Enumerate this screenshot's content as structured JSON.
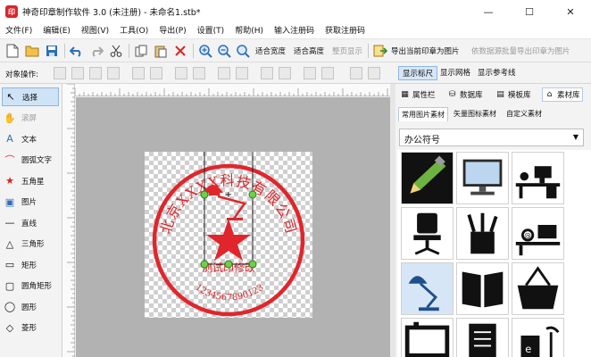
{
  "window": {
    "title": "神奇印章制作软件 3.0 (未注册) - 未命名1.stb*",
    "app_icon_glyph": "印",
    "controls": {
      "minimize": "—",
      "maximize": "☐",
      "close": "✕"
    }
  },
  "menu": [
    "文件(F)",
    "编辑(E)",
    "视图(V)",
    "工具(O)",
    "导出(P)",
    "设置(T)",
    "帮助(H)",
    "输入注册码",
    "获取注册码"
  ],
  "toolbar": {
    "fit_width": "适合宽度",
    "fit_height": "适合高度",
    "full_display": "整页显示",
    "export_image": "导出当前印章为图片",
    "export_bg": "依数据源批量导出印章为图片"
  },
  "object_bar": {
    "label": "对象操作:",
    "tabs": [
      "显示标尺",
      "显示网格",
      "显示参考线"
    ]
  },
  "tools": [
    {
      "name": "select",
      "icon": "pointer-icon",
      "glyph": "↖",
      "label": "选择",
      "active": true,
      "disabled": false
    },
    {
      "name": "pan",
      "icon": "hand-icon",
      "glyph": "✋",
      "label": "滚屏",
      "active": false,
      "disabled": true
    },
    {
      "name": "text",
      "icon": "text-icon",
      "glyph": "A",
      "label": "文本",
      "active": false,
      "disabled": false
    },
    {
      "name": "arc-text",
      "icon": "arc-text-icon",
      "glyph": "⌒",
      "label": "圆弧文字",
      "active": false,
      "disabled": false
    },
    {
      "name": "star",
      "icon": "star-icon",
      "glyph": "★",
      "label": "五角星",
      "active": false,
      "disabled": false
    },
    {
      "name": "image",
      "icon": "image-icon",
      "glyph": "▣",
      "label": "图片",
      "active": false,
      "disabled": false
    },
    {
      "name": "line",
      "icon": "line-icon",
      "glyph": "—",
      "label": "直线",
      "active": false,
      "disabled": false
    },
    {
      "name": "triangle",
      "icon": "triangle-icon",
      "glyph": "△",
      "label": "三角形",
      "active": false,
      "disabled": false
    },
    {
      "name": "rectangle",
      "icon": "rectangle-icon",
      "glyph": "▭",
      "label": "矩形",
      "active": false,
      "disabled": false
    },
    {
      "name": "rounded-rect",
      "icon": "rounded-rect-icon",
      "glyph": "▢",
      "label": "圆角矩形",
      "active": false,
      "disabled": false
    },
    {
      "name": "ellipse",
      "icon": "ellipse-icon",
      "glyph": "◯",
      "label": "圆形",
      "active": false,
      "disabled": false
    },
    {
      "name": "diamond",
      "icon": "diamond-icon",
      "glyph": "◇",
      "label": "菱形",
      "active": false,
      "disabled": false
    }
  ],
  "stamp": {
    "arc_text": "北京XXXX科技有限公司",
    "subtitle": "测试印修改",
    "number": "1234567890123",
    "color": "#e0262c"
  },
  "panel": {
    "tabs": [
      {
        "icon": "properties-icon",
        "label": "属性栏"
      },
      {
        "icon": "database-icon",
        "label": "数据库"
      },
      {
        "icon": "template-icon",
        "label": "模板库"
      },
      {
        "icon": "library-icon",
        "label": "素材库"
      }
    ],
    "sub_tabs": [
      "常用图片素材",
      "矢量图标素材",
      "自定义素材"
    ],
    "category": "办公符号",
    "cells": [
      {
        "name": "pencil-symbol"
      },
      {
        "name": "monitor-symbol"
      },
      {
        "name": "desk-computer-symbol"
      },
      {
        "name": "office-chair-symbol"
      },
      {
        "name": "pen-holder-symbol"
      },
      {
        "name": "workstation-symbol"
      },
      {
        "name": "desk-lamp-symbol"
      },
      {
        "name": "open-binder-symbol"
      },
      {
        "name": "basket-symbol"
      },
      {
        "name": "tv-board-symbol"
      },
      {
        "name": "notebook-symbol"
      },
      {
        "name": "lamp-book-symbol"
      }
    ]
  }
}
